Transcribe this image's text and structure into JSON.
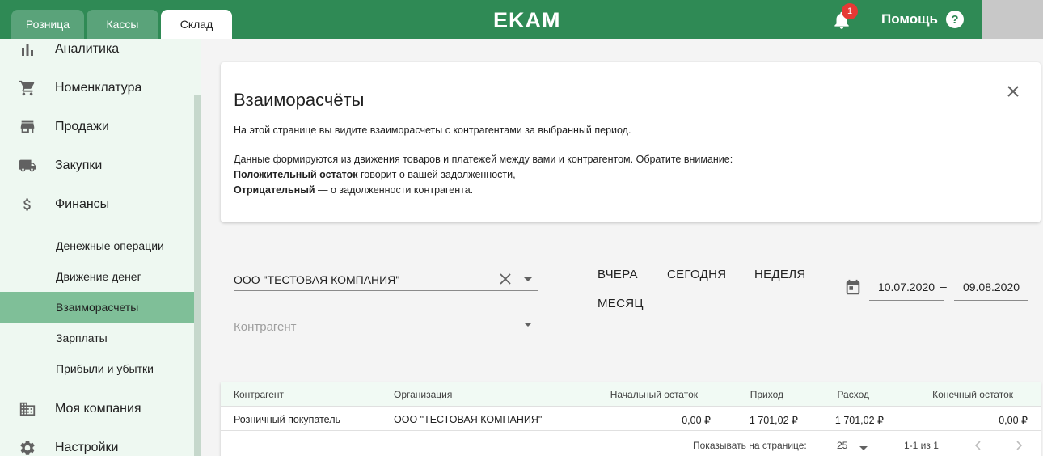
{
  "header": {
    "tabs": [
      {
        "label": "Розница"
      },
      {
        "label": "Кассы"
      },
      {
        "label": "Склад"
      }
    ],
    "logo": "EKAM",
    "notifications_count": "1",
    "help_label": "Помощь",
    "help_icon_glyph": "?"
  },
  "sidebar": {
    "items": [
      {
        "label": "Аналитика",
        "icon": "bar-chart-icon"
      },
      {
        "label": "Номенклатура",
        "icon": "cart-icon"
      },
      {
        "label": "Продажи",
        "icon": "store-icon"
      },
      {
        "label": "Закупки",
        "icon": "truck-icon"
      },
      {
        "label": "Финансы",
        "icon": "dollar-icon"
      },
      {
        "label": "Моя компания",
        "icon": "building-icon"
      },
      {
        "label": "Настройки",
        "icon": "gear-icon"
      }
    ],
    "finance_sub": [
      {
        "label": "Денежные операции"
      },
      {
        "label": "Движение денег"
      },
      {
        "label": "Взаиморасчеты",
        "active": true
      },
      {
        "label": "Зарплаты"
      },
      {
        "label": "Прибыли и убытки"
      }
    ]
  },
  "info": {
    "title": "Взаиморасчёты",
    "line1": "На этой странице вы видите взаиморасчеты с контрагентами за выбранный период.",
    "line2": "Данные формируются из движения товаров и платежей между вами и контрагентом. Обратите внимание:",
    "line3_bold": "Положительный остаток",
    "line3_rest": " говорит о вашей задолженности,",
    "line4_bold": "Отрицательный",
    "line4_rest": " — о задолженности контрагента."
  },
  "filters": {
    "organization_value": "ООО \"ТЕСТОВАЯ КОМПАНИЯ\"",
    "counterparty_placeholder": "Контрагент",
    "periods": [
      "ВЧЕРА",
      "СЕГОДНЯ",
      "НЕДЕЛЯ",
      "МЕСЯЦ"
    ],
    "date_from": "10.07.2020",
    "date_to": "09.08.2020",
    "date_separator": "–"
  },
  "table": {
    "columns": [
      "Контрагент",
      "Организация",
      "Начальный остаток",
      "Приход",
      "Расход",
      "Конечный остаток"
    ],
    "rows": [
      [
        "Розничный покупатель",
        "ООО \"ТЕСТОВАЯ КОМПАНИЯ\"",
        "0,00 ₽",
        "1 701,02 ₽",
        "1 701,02 ₽",
        "0,00 ₽"
      ]
    ],
    "per_page_label": "Показывать на странице:",
    "per_page_value": "25",
    "range_label": "1-1 из 1"
  },
  "colors": {
    "brand": "#2f8a55",
    "active_sub": "#7fbf98",
    "badge": "#e53935"
  }
}
